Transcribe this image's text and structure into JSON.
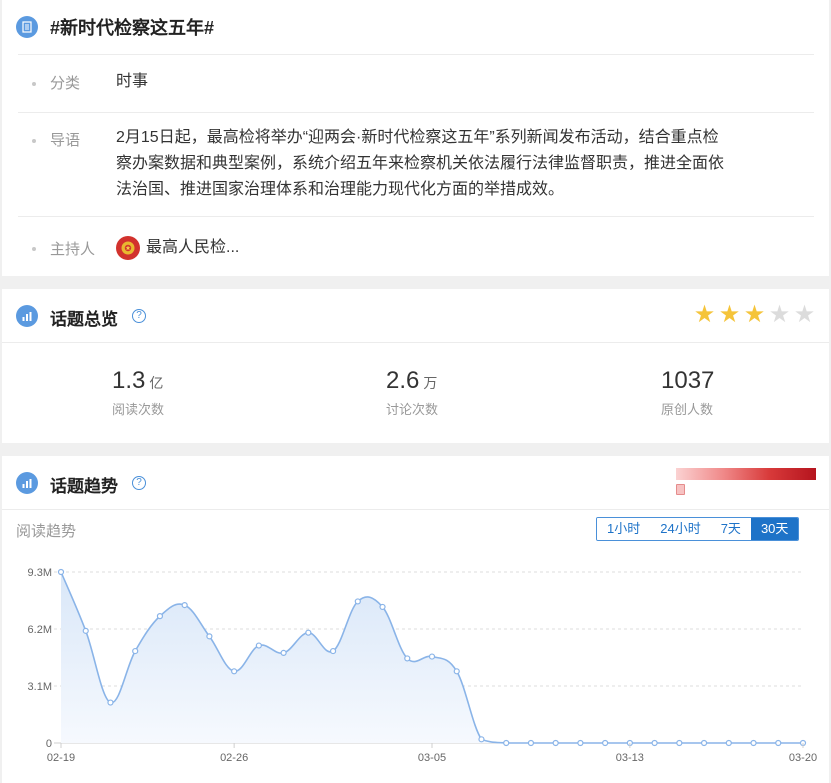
{
  "topic": {
    "title": "#新时代检察这五年#",
    "category_label": "分类",
    "category_value": "时事",
    "intro_label": "导语",
    "intro_lines": [
      "2月15日起，最高检将举办“迎两会·新时代检察这五年”系列新闻发布活动，结合重点检",
      "察办案数据和典型案例，系统介绍五年来检察机关依法履行法律监督职责，推进全面依",
      "法治国、推进国家治理体系和治理能力现代化方面的举措成效。"
    ],
    "host_label": "主持人",
    "host_name": "最高人民检..."
  },
  "overview": {
    "title": "话题总览",
    "help": "?",
    "rating": 3,
    "rating_max": 5,
    "star_glyph": "★",
    "stats": [
      {
        "value": "1.3",
        "unit": "亿",
        "label": "阅读次数"
      },
      {
        "value": "2.6",
        "unit": "万",
        "label": "讨论次数"
      },
      {
        "value": "1037",
        "unit": "",
        "label": "原创人数"
      }
    ]
  },
  "trend": {
    "title": "话题趋势",
    "help": "?",
    "sub_label": "阅读趋势",
    "ranges": [
      "1小时",
      "24小时",
      "7天",
      "30天"
    ],
    "active_range": "30天"
  },
  "colors": {
    "accent": "#1e73c8",
    "icon_bg": "#5b9ae0",
    "star_on": "#f5c43a",
    "star_off": "#dcdcdc",
    "line": "#8ab4e8",
    "area": "#e9f1fb"
  },
  "chart_data": {
    "type": "area",
    "title": "",
    "xlabel": "",
    "ylabel": "",
    "x": [
      "02-19",
      "02-20",
      "02-21",
      "02-22",
      "02-23",
      "02-24",
      "02-25",
      "02-26",
      "02-27",
      "02-28",
      "02-29",
      "03-01",
      "03-02",
      "03-03",
      "03-04",
      "03-05",
      "03-06",
      "03-07",
      "03-08",
      "03-09",
      "03-10",
      "03-11",
      "03-12",
      "03-13",
      "03-14",
      "03-15",
      "03-16",
      "03-17",
      "03-18",
      "03-19",
      "03-20"
    ],
    "x_ticks": [
      "02-19",
      "02-26",
      "03-05",
      "03-13",
      "03-20"
    ],
    "y_ticks": [
      {
        "value": 0,
        "label": "0"
      },
      {
        "value": 3.1,
        "label": "3.1M"
      },
      {
        "value": 6.2,
        "label": "6.2M"
      },
      {
        "value": 9.3,
        "label": "9.3M"
      }
    ],
    "ylim": [
      0,
      9.3
    ],
    "series": [
      {
        "values": [
          9.3,
          6.1,
          2.2,
          5.0,
          6.9,
          7.5,
          5.8,
          3.9,
          5.3,
          4.9,
          6.0,
          5.0,
          7.7,
          7.4,
          4.6,
          4.7,
          3.9,
          0.2,
          0.0,
          0.0,
          0.0,
          0.0,
          0.0,
          0.0,
          0.0,
          0.0,
          0.0,
          0.0,
          0.0,
          0.0,
          0.0
        ]
      }
    ],
    "grid": true,
    "legend": "none"
  }
}
